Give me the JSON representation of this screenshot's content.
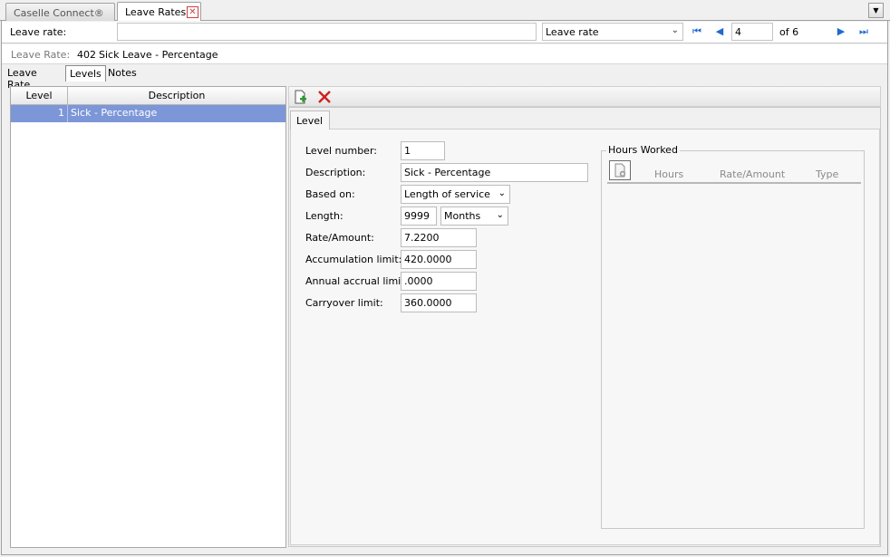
{
  "doc_tabs": [
    {
      "label": "Caselle Connect®"
    },
    {
      "label": "Leave Rates"
    }
  ],
  "record_nav": {
    "field_label": "Leave rate:",
    "search_value": "",
    "lookup_select": "Leave rate",
    "current_record": "4",
    "of_total": "of 6"
  },
  "summary": {
    "label": "Leave Rate:",
    "code": "402",
    "description": "Sick Leave - Percentage"
  },
  "sub_tabs": [
    "Leave Rate",
    "Levels",
    "Notes"
  ],
  "active_sub_tab": "Levels",
  "levels_grid": {
    "columns": [
      "Level",
      "Description"
    ],
    "rows": [
      {
        "level": "1",
        "description": "Sick - Percentage",
        "selected": true
      }
    ]
  },
  "detail": {
    "tab_label": "Level",
    "fields": {
      "level_number": {
        "label": "Level number:",
        "value": "1"
      },
      "description": {
        "label": "Description:",
        "value": "Sick - Percentage"
      },
      "based_on": {
        "label": "Based on:",
        "value": "Length of service"
      },
      "length": {
        "label": "Length:",
        "value": "9999",
        "unit": "Months"
      },
      "rate_amount": {
        "label": "Rate/Amount:",
        "value": "7.2200"
      },
      "accumulation_limit": {
        "label": "Accumulation limit:",
        "value": "420.0000"
      },
      "annual_accrual_limit": {
        "label": "Annual accrual limit:",
        "value": ".0000"
      },
      "carryover_limit": {
        "label": "Carryover limit:",
        "value": "360.0000"
      }
    },
    "hours_worked": {
      "title": "Hours Worked",
      "columns": [
        "Hours",
        "Rate/Amount",
        "Type"
      ]
    }
  },
  "colors": {
    "selected_row": "#7c96d8",
    "nav_arrow": "#1e6ad0",
    "delete_red": "#d02020"
  },
  "icons": [
    "close-tab-icon",
    "dropdown-menu-icon",
    "first-record-icon",
    "previous-record-icon",
    "next-record-icon",
    "last-record-icon",
    "add-record-icon",
    "delete-record-icon",
    "add-row-icon",
    "chevron-down-icon"
  ]
}
